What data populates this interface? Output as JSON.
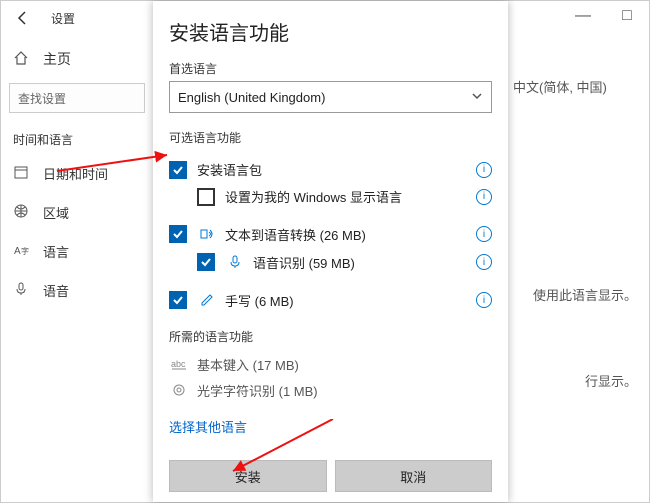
{
  "titlebar": {
    "back": "←",
    "title": "设置"
  },
  "wincontrols": {
    "min": "—",
    "max": "□"
  },
  "sidebar": {
    "home_label": "主页",
    "search_placeholder": "查找设置",
    "section": "时间和语言",
    "items": [
      {
        "label": "日期和时间"
      },
      {
        "label": "区域"
      },
      {
        "label": "语言"
      },
      {
        "label": "语音"
      }
    ]
  },
  "right": {
    "lang_tag": "中文(简体, 中国)",
    "msg1": "使用此语言显示。",
    "msg2": "行显示。"
  },
  "dialog": {
    "title": "安装语言功能",
    "preferred_label": "首选语言",
    "dropdown_value": "English (United Kingdom)",
    "optional_title": "可选语言功能",
    "opts": {
      "pack": "安装语言包",
      "display": "设置为我的 Windows 显示语言",
      "tts": "文本到语音转换 (26 MB)",
      "speech": "语音识别 (59 MB)",
      "hand": "手写 (6 MB)"
    },
    "required_title": "所需的语言功能",
    "req": {
      "typing": "基本键入 (17 MB)",
      "ocr": "光学字符识别 (1 MB)"
    },
    "link": "选择其他语言",
    "install": "安装",
    "cancel": "取消",
    "info": "i"
  }
}
